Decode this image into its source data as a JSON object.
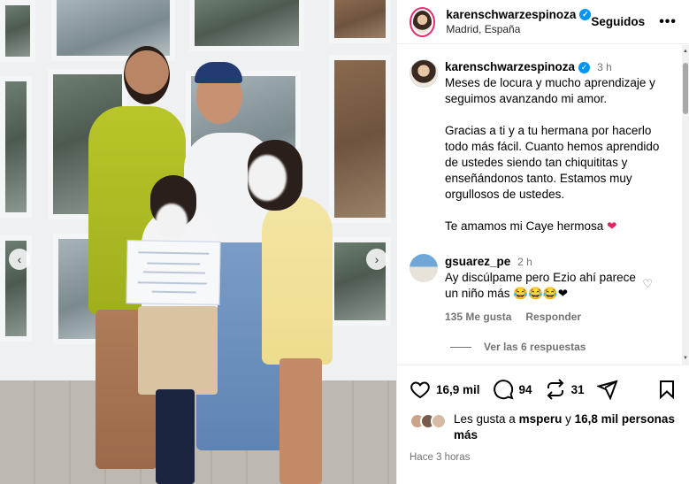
{
  "post": {
    "username": "karenschwarzespinoza",
    "location": "Madrid, España",
    "follow_status": "Seguidos",
    "more_glyph": "•••"
  },
  "caption": {
    "username": "karenschwarzespinoza",
    "time": "3 h",
    "paragraphs": [
      "Meses de locura y mucho aprendizaje y seguimos avanzando mi amor.",
      "Gracias a ti y a tu hermana por hacerlo todo más fácil. Cuanto hemos aprendido de ustedes siendo tan chiquititas y enseñándonos tanto. Estamos muy orgullosos de ustedes.",
      "Te amamos mi Caye hermosa"
    ],
    "emoji": "❤"
  },
  "comment": {
    "username": "gsuarez_pe",
    "time": "2 h",
    "text": "Ay discúlpame pero Ezio ahí parece un niño más",
    "emojis": "😂😂😂❤",
    "likes": "135 Me gusta",
    "reply_label": "Responder",
    "view_replies": "Ver las 6 respuestas"
  },
  "actions": {
    "like_count": "16,9 mil",
    "comment_count": "94",
    "repost_count": "31"
  },
  "likes_line": {
    "prefix": "Les gusta a",
    "user": "msperu",
    "middle": "y",
    "others": "16,8 mil personas más"
  },
  "timestamp": "Hace 3 horas",
  "colors": {
    "accent": "#0095f6",
    "heart": "#e0245e",
    "muted": "#737373",
    "story_ring": "#e1306c"
  },
  "icons": [
    "heart-icon",
    "comment-icon",
    "repost-icon",
    "share-icon",
    "bookmark-icon",
    "verified-icon",
    "chevron-left-icon",
    "chevron-right-icon"
  ]
}
